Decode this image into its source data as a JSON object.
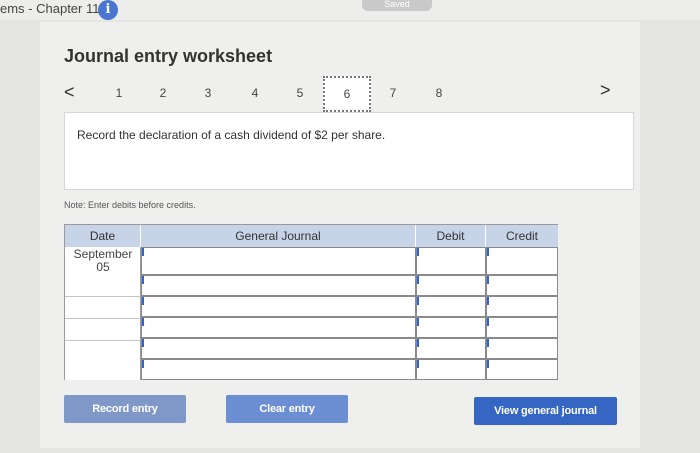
{
  "header": {
    "breadcrumb": "ems - Chapter 11",
    "info_glyph": "i",
    "saved_label": "Saved"
  },
  "worksheet": {
    "title": "Journal entry worksheet",
    "prev_glyph": "<",
    "next_glyph": ">",
    "steps": [
      "1",
      "2",
      "3",
      "4",
      "5",
      "6",
      "7",
      "8"
    ],
    "active_step": "6",
    "prompt": "Record the declaration of a cash dividend of $2 per share.",
    "note": "Note: Enter debits before credits."
  },
  "journal": {
    "columns": {
      "date": "Date",
      "general_journal": "General Journal",
      "debit": "Debit",
      "credit": "Credit"
    },
    "rows": [
      {
        "date_line1": "September",
        "date_line2": "05",
        "account": "",
        "debit": "",
        "credit": ""
      },
      {
        "date_line1": "",
        "date_line2": "",
        "account": "",
        "debit": "",
        "credit": ""
      },
      {
        "date_line1": "",
        "date_line2": "",
        "account": "",
        "debit": "",
        "credit": ""
      },
      {
        "date_line1": "",
        "date_line2": "",
        "account": "",
        "debit": "",
        "credit": ""
      },
      {
        "date_line1": "",
        "date_line2": "",
        "account": "",
        "debit": "",
        "credit": ""
      },
      {
        "date_line1": "",
        "date_line2": "",
        "account": "",
        "debit": "",
        "credit": ""
      }
    ]
  },
  "buttons": {
    "record_entry": "Record entry",
    "clear_entry": "Clear entry",
    "view_general_journal": "View general journal"
  }
}
